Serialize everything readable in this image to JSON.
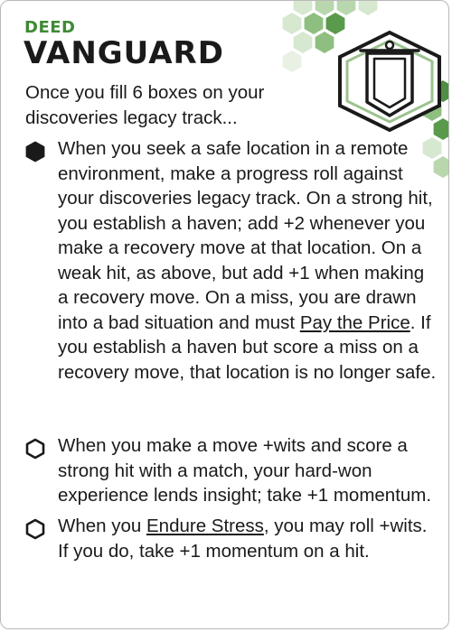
{
  "card": {
    "type": "DEED",
    "title": "VANGUARD",
    "intro": "Once you fill 6 boxes on your discoveries legacy track...",
    "accent_color": "#3e8a35",
    "icon": "banner-icon",
    "abilities": [
      {
        "marker": "filled-hexagon",
        "segments": [
          "When you seek a safe location in a remote environment, make a progress roll against your discoveries legacy track. On a strong hit, you establish a haven; add +2 whenever you make a recovery move at that location. On a weak hit, as above, but add +1 when making a recovery move. On a miss, you are drawn into a bad situation and must ",
          "Pay the Price",
          ". If you establish a haven but score a miss on a recovery move, that location is no longer safe."
        ]
      },
      {
        "marker": "empty-hexagon",
        "text": "When you make a move +wits and score a strong hit with a match, your hard-won experience lends insight; take +1 momentum."
      },
      {
        "marker": "empty-hexagon",
        "segments": [
          "When you ",
          "Endure Stress",
          ", you may roll +wits. If you do, take +1 momentum on a hit."
        ]
      }
    ]
  }
}
